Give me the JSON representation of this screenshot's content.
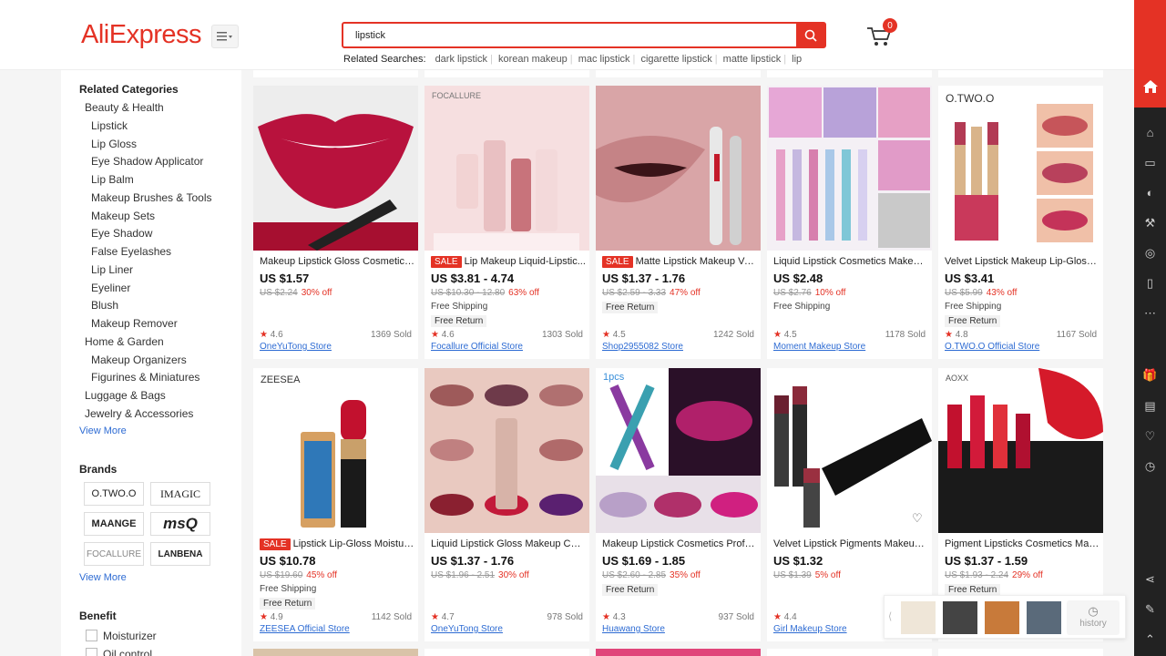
{
  "header": {
    "logo": "AliExpress",
    "search_value": "lipstick",
    "related_label": "Related Searches:",
    "related": [
      "dark lipstick",
      "korean makeup",
      "mac lipstick",
      "cigarette lipstick",
      "matte lipstick",
      "lip"
    ],
    "cart_count": "0"
  },
  "sidebar": {
    "related_categories_title": "Related Categories",
    "categories": [
      {
        "label": "Beauty & Health",
        "level": 1
      },
      {
        "label": "Lipstick",
        "level": 2
      },
      {
        "label": "Lip Gloss",
        "level": 2
      },
      {
        "label": "Eye Shadow Applicator",
        "level": 2
      },
      {
        "label": "Lip Balm",
        "level": 2
      },
      {
        "label": "Makeup Brushes & Tools",
        "level": 2
      },
      {
        "label": "Makeup Sets",
        "level": 2
      },
      {
        "label": "Eye Shadow",
        "level": 2
      },
      {
        "label": "False Eyelashes",
        "level": 2
      },
      {
        "label": "Lip Liner",
        "level": 2
      },
      {
        "label": "Eyeliner",
        "level": 2
      },
      {
        "label": "Blush",
        "level": 2
      },
      {
        "label": "Makeup Remover",
        "level": 2
      },
      {
        "label": "Home & Garden",
        "level": 1
      },
      {
        "label": "Makeup Organizers",
        "level": 2
      },
      {
        "label": "Figurines & Miniatures",
        "level": 2
      },
      {
        "label": "Luggage & Bags",
        "level": 1
      },
      {
        "label": "Jewelry & Accessories",
        "level": 1
      }
    ],
    "view_more": "View More",
    "brands_title": "Brands",
    "brands": [
      "O.TWO.O",
      "IMAGIC",
      "MAANGE",
      "msQ",
      "FOCALLURE",
      "LANBENA"
    ],
    "brands_view_more": "View More",
    "benefit_title": "Benefit",
    "benefits": [
      "Moisturizer",
      "Oil control"
    ]
  },
  "products": [
    {
      "title": "Makeup Lipstick Gloss Cosmetics L...",
      "sale": false,
      "price": "US $1.57",
      "old_price": "US $2.24",
      "discount": "30% off",
      "shipping": "",
      "free_return": false,
      "rating": "4.6",
      "sold": "1369 Sold",
      "store": "OneYuTong Store"
    },
    {
      "title": "Lip Makeup Liquid-Lipstic...",
      "sale": true,
      "price": "US $3.81 - 4.74",
      "old_price": "US $10.30 - 12.80",
      "discount": "63% off",
      "shipping": "Free Shipping",
      "free_return": true,
      "rating": "4.6",
      "sold": "1303 Sold",
      "store": "Focallure Official Store"
    },
    {
      "title": "Matte Lipstick Makeup Vel...",
      "sale": true,
      "price": "US $1.37 - 1.76",
      "old_price": "US $2.59 - 3.33",
      "discount": "47% off",
      "shipping": "",
      "free_return": true,
      "rating": "4.5",
      "sold": "1242 Sold",
      "store": "Shop2955082 Store"
    },
    {
      "title": "Liquid Lipstick Cosmetics Makeup ...",
      "sale": false,
      "price": "US $2.48",
      "old_price": "US $2.76",
      "discount": "10% off",
      "shipping": "Free Shipping",
      "free_return": false,
      "rating": "4.5",
      "sold": "1178 Sold",
      "store": "Moment Makeup Store"
    },
    {
      "title": "Velvet Lipstick Makeup Lip-Gloss ...",
      "sale": false,
      "price": "US $3.41",
      "old_price": "US $5.99",
      "discount": "43% off",
      "shipping": "Free Shipping",
      "free_return": true,
      "rating": "4.8",
      "sold": "1167 Sold",
      "store": "O.TWO.O Official Store"
    },
    {
      "title": "Lipstick Lip-Gloss Moistur...",
      "sale": true,
      "price": "US $10.78",
      "old_price": "US $19.60",
      "discount": "45% off",
      "shipping": "Free Shipping",
      "free_return": true,
      "rating": "4.9",
      "sold": "1142 Sold",
      "store": "ZEESEA Official Store"
    },
    {
      "title": "Liquid Lipstick Gloss Makeup Cos...",
      "sale": false,
      "price": "US $1.37 - 1.76",
      "old_price": "US $1.96 - 2.51",
      "discount": "30% off",
      "shipping": "",
      "free_return": false,
      "rating": "4.7",
      "sold": "978 Sold",
      "store": "OneYuTong Store"
    },
    {
      "title": "Makeup Lipstick Cosmetics Profes...",
      "sale": false,
      "price": "US $1.69 - 1.85",
      "old_price": "US $2.60 - 2.85",
      "discount": "35% off",
      "shipping": "",
      "free_return": true,
      "rating": "4.3",
      "sold": "937 Sold",
      "store": "Huawang Store"
    },
    {
      "title": "Velvet Lipstick Pigments Makeup ...",
      "sale": false,
      "price": "US $1.32",
      "old_price": "US $1.39",
      "discount": "5% off",
      "shipping": "",
      "free_return": false,
      "rating": "4.4",
      "sold": "",
      "store": "Girl Makeup Store"
    },
    {
      "title": "Pigment Lipsticks Cosmetics Make...",
      "sale": false,
      "price": "US $1.37 - 1.59",
      "old_price": "US $1.93 - 2.24",
      "discount": "29% off",
      "shipping": "",
      "free_return": true,
      "rating": "",
      "sold": "",
      "store": ""
    }
  ],
  "labels": {
    "sale": "SALE",
    "free_return": "Free Return",
    "star": "★"
  },
  "image_text": {
    "focallure": "FOCALLURE",
    "otwoo": "O.TWO.O",
    "zeesea": "ZEESEA",
    "onepcs": "1pcs",
    "aoxx": "AOXX"
  },
  "history": {
    "label": "history"
  },
  "colors": {
    "brand": "#e43225",
    "link": "#2d6bd3"
  }
}
